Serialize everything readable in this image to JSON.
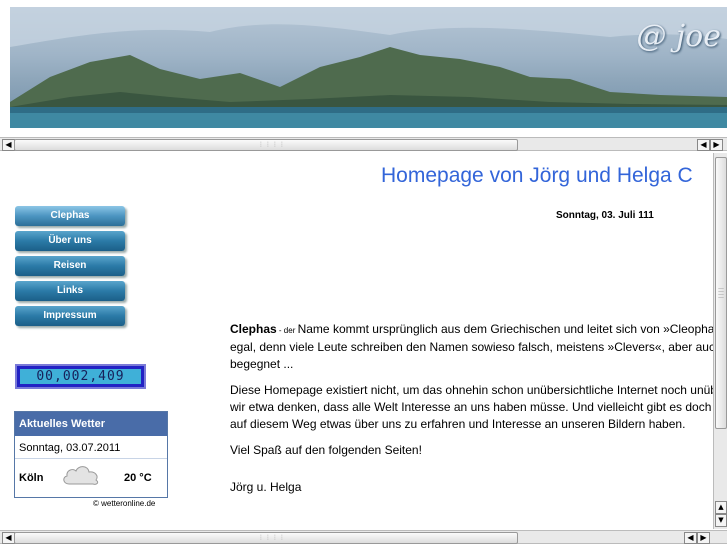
{
  "banner": {
    "logo_text": "@ joe",
    "scroll_left_icon": "◀",
    "scroll_right_icon": "▶"
  },
  "heading": "Homepage von Jörg und Helga C",
  "date": "Sonntag, 03. Juli 111",
  "nav": {
    "items": [
      {
        "label": "Clephas",
        "active": true
      },
      {
        "label": "Über uns",
        "active": false
      },
      {
        "label": "Reisen",
        "active": false
      },
      {
        "label": "Links",
        "active": false
      },
      {
        "label": "Impressum",
        "active": false
      }
    ]
  },
  "counter": "00,002,409",
  "weather": {
    "title": "Aktuelles Wetter",
    "date": "Sonntag, 03.07.2011",
    "city": "Köln",
    "temperature": "20 °C",
    "condition_icon": "cloud-icon",
    "credit": "© wetteronline.de"
  },
  "main": {
    "lead_word": "Clephas",
    "lead_small": " - der ",
    "para1_rest": "Name kommt ursprünglich aus dem Griechischen und leitet sich von »Cleopha",
    "para1_line2": "egal, denn viele Leute schreiben den Namen sowieso falsch, meistens »Clevers«, aber auch",
    "para1_line3": "begegnet ...",
    "para2_line1": "Diese Homepage existiert nicht, um das ohnehin schon unübersichtliche Internet noch unüb",
    "para2_line2": "wir etwa denken, dass alle Welt Interesse an uns haben müsse. Und vielleicht gibt es doch",
    "para2_line3": "auf diesem Weg etwas über uns zu erfahren und Interesse an unseren Bildern haben.",
    "para3": "Viel Spaß auf den folgenden Seiten!",
    "signature": "Jörg u. Helga"
  },
  "scrollbars": {
    "left_arrow": "◀",
    "right_arrow": "▶",
    "up_arrow": "▲",
    "down_arrow": "▼"
  }
}
